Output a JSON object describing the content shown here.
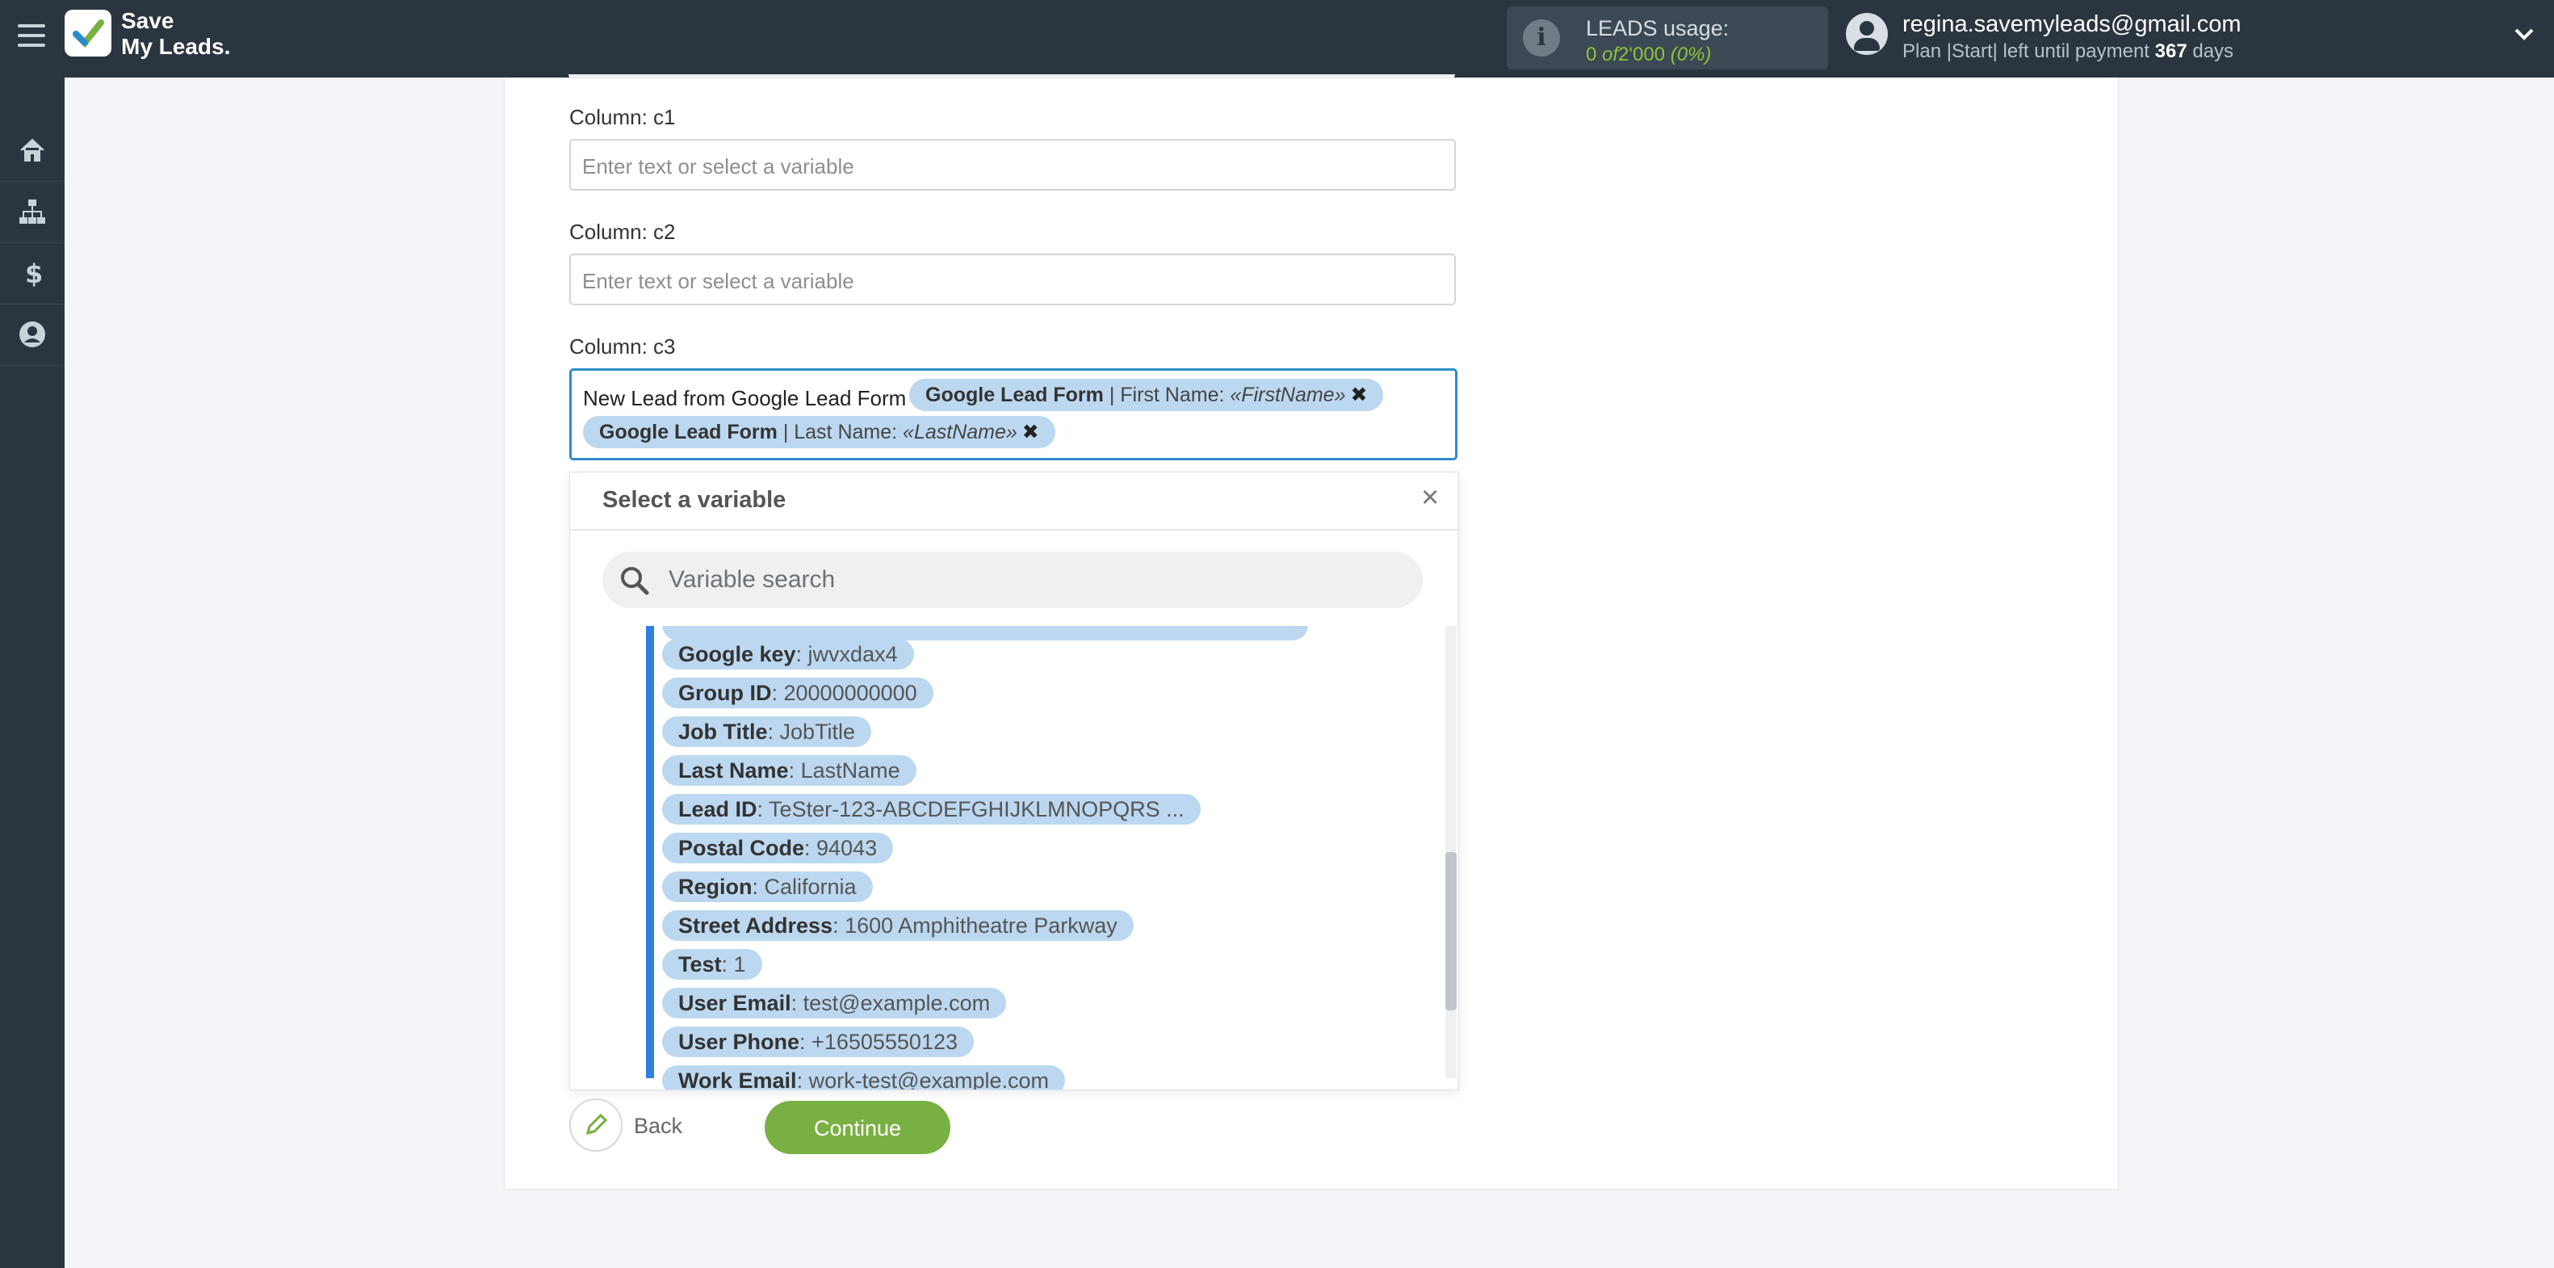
{
  "header": {
    "logo_line1": "Save",
    "logo_line2": "My Leads.",
    "usage_title": "LEADS usage:",
    "usage_value": "0",
    "usage_of": "of",
    "usage_total": "2'000",
    "usage_percent": "(0%)",
    "user_email": "regina.savemyleads@gmail.com",
    "plan_text": "Plan |Start| left until payment",
    "plan_days": "367",
    "plan_days_unit": "days"
  },
  "sidebar": {
    "items": [
      "home-icon",
      "sitemap-icon",
      "dollar-icon",
      "account-icon"
    ]
  },
  "form": {
    "c1_label": "Column: c1",
    "c1_placeholder": "Enter text or select a variable",
    "c2_label": "Column: c2",
    "c2_placeholder": "Enter text or select a variable",
    "c3_label": "Column: c3",
    "c3_static_text": "New Lead from Google Lead Form",
    "c3_tags": [
      {
        "source": "Google Lead Form",
        "field": "| First Name:",
        "value": "«FirstName»"
      },
      {
        "source": "Google Lead Form",
        "field": "| Last Name:",
        "value": "«LastName»"
      }
    ]
  },
  "dropdown": {
    "title": "Select a variable",
    "close": "×",
    "search_placeholder": "Variable search",
    "items": [
      {
        "key": "Google key",
        "value": ": jwvxdax4"
      },
      {
        "key": "Group ID",
        "value": ": 20000000000"
      },
      {
        "key": "Job Title",
        "value": ": JobTitle"
      },
      {
        "key": "Last Name",
        "value": ": LastName"
      },
      {
        "key": "Lead ID",
        "value": ": TeSter-123-ABCDEFGHIJKLMNOPQRS ..."
      },
      {
        "key": "Postal Code",
        "value": ": 94043"
      },
      {
        "key": "Region",
        "value": ": California"
      },
      {
        "key": "Street Address",
        "value": ": 1600 Amphitheatre Parkway"
      },
      {
        "key": "Test",
        "value": ": 1"
      },
      {
        "key": "User Email",
        "value": ": test@example.com"
      },
      {
        "key": "User Phone",
        "value": ": +16505550123"
      },
      {
        "key": "Work Email",
        "value": ": work-test@example.com"
      }
    ]
  },
  "actions": {
    "back_label": "Back",
    "continue_label": "Continue"
  },
  "colors": {
    "topbar": "#2a3540",
    "accent_blue": "#2e8bc9",
    "tag_bg": "#bcd8f0",
    "continue_green": "#79b043",
    "usage_green": "#8cc43c"
  }
}
